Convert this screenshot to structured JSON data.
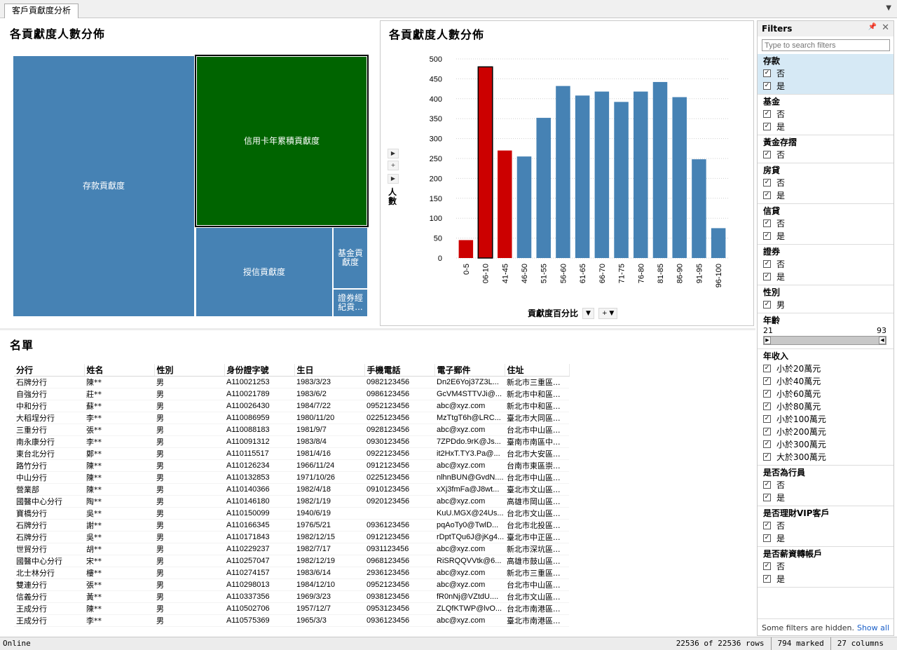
{
  "tab": {
    "label": "客戶貢獻度分析"
  },
  "treemap": {
    "title": "各貢獻度人數分佈",
    "cells": [
      {
        "label": "存款貢獻度"
      },
      {
        "label": "信用卡年累積貢獻度"
      },
      {
        "label": "授信貢獻度"
      },
      {
        "label": "基金貢獻度"
      },
      {
        "label": "證券經紀貢..."
      }
    ]
  },
  "bar": {
    "title": "各貢獻度人數分佈",
    "ylabel": "人數",
    "xlabel": "貢獻度百分比"
  },
  "chart_data": {
    "type": "bar",
    "title": "各貢獻度人數分佈",
    "xlabel": "貢獻度百分比",
    "ylabel": "人數",
    "categories": [
      "0-5",
      "06-10",
      "41-45",
      "46-50",
      "51-55",
      "56-60",
      "61-65",
      "66-70",
      "71-75",
      "76-80",
      "81-85",
      "86-90",
      "91-95",
      "96-100"
    ],
    "values": [
      45,
      480,
      270,
      255,
      352,
      432,
      408,
      418,
      392,
      418,
      442,
      404,
      248,
      75
    ],
    "marked": [
      true,
      true,
      true,
      false,
      false,
      false,
      false,
      false,
      false,
      false,
      false,
      false,
      false,
      false
    ],
    "ylim": [
      0,
      500
    ],
    "yticks": [
      0,
      50,
      100,
      150,
      200,
      250,
      300,
      350,
      400,
      450,
      500
    ],
    "colors": {
      "normal": "#4682b4",
      "marked": "#cc0000"
    },
    "grid": true
  },
  "list": {
    "title": "名單",
    "columns": [
      "分行",
      "姓名",
      "性別",
      "身份證字號",
      "生日",
      "手機電話",
      "電子郵件",
      "住址"
    ],
    "rows": [
      [
        "石牌分行",
        "陳**",
        "男",
        "A110021253",
        "1983/3/23",
        "0982123456",
        "Dn2E6Yoj37Z3L...",
        "新北市三重區..."
      ],
      [
        "自強分行",
        "莊**",
        "男",
        "A110021789",
        "1983/6/2",
        "0986123456",
        "GcVM4STTVJi@...",
        "新北市中和區..."
      ],
      [
        "中和分行",
        "蘇**",
        "男",
        "A110026430",
        "1984/7/22",
        "0952123456",
        "abc@xyz.com",
        "新北市中和區..."
      ],
      [
        "大稻埕分行",
        "李**",
        "男",
        "A110086959",
        "1980/11/20",
        "0225123456",
        "MzTtgT6h@LRC...",
        "臺北市大同區..."
      ],
      [
        "三重分行",
        "張**",
        "男",
        "A110088183",
        "1981/9/7",
        "0928123456",
        "abc@xyz.com",
        "台北市中山區..."
      ],
      [
        "南永康分行",
        "李**",
        "男",
        "A110091312",
        "1983/8/4",
        "0930123456",
        "7ZPDdo.9rK@Js...",
        "臺南市南區中..."
      ],
      [
        "東台北分行",
        "鄭**",
        "男",
        "A110115517",
        "1981/4/16",
        "0922123456",
        "it2HxT.TY3.Pa@...",
        "台北市大安區..."
      ],
      [
        "路竹分行",
        "陳**",
        "男",
        "A110126234",
        "1966/11/24",
        "0912123456",
        "abc@xyz.com",
        "台南市東區崇..."
      ],
      [
        "中山分行",
        "陳**",
        "男",
        "A110132853",
        "1971/10/26",
        "0225123456",
        "nlhnBUN@GvdN....",
        "台北市中山區..."
      ],
      [
        "營業部",
        "陳**",
        "男",
        "A110140366",
        "1982/4/18",
        "0910123456",
        "xXj3fmFa@J8wt...",
        "臺北市文山區..."
      ],
      [
        "國醫中心分行",
        "陶**",
        "男",
        "A110146180",
        "1982/1/19",
        "0920123456",
        "abc@xyz.com",
        "高雄市岡山區..."
      ],
      [
        "寶橋分行",
        "吳**",
        "男",
        "A110150099",
        "1940/6/19",
        "",
        "KuU.MGX@24Us...",
        "台北市文山區..."
      ],
      [
        "石牌分行",
        "謝**",
        "男",
        "A110166345",
        "1976/5/21",
        "0936123456",
        "pqAoTy0@TwlD...",
        "台北市北投區..."
      ],
      [
        "石牌分行",
        "吳**",
        "男",
        "A110171843",
        "1982/12/15",
        "0912123456",
        "rDptTQu6J@jKg4...",
        "臺北市中正區..."
      ],
      [
        "世貿分行",
        "胡**",
        "男",
        "A110229237",
        "1982/7/17",
        "0931123456",
        "abc@xyz.com",
        "新北市深坑區..."
      ],
      [
        "國醫中心分行",
        "宋**",
        "男",
        "A110257047",
        "1982/12/19",
        "0968123456",
        "RiSRQQVVtk@6...",
        "高雄市鼓山區..."
      ],
      [
        "北士林分行",
        "樓**",
        "男",
        "A110274157",
        "1983/6/14",
        "2936123456",
        "abc@xyz.com",
        "新北市三重區..."
      ],
      [
        "雙連分行",
        "張**",
        "男",
        "A110298013",
        "1984/12/10",
        "0952123456",
        "abc@xyz.com",
        "台北市中山區..."
      ],
      [
        "信義分行",
        "黃**",
        "男",
        "A110337356",
        "1969/3/23",
        "0938123456",
        "fR0nNj@VZtdU....",
        "台北市文山區..."
      ],
      [
        "王成分行",
        "陳**",
        "男",
        "A110502706",
        "1957/12/7",
        "0953123456",
        "ZLQfKTWP@lvO...",
        "台北市南港區..."
      ],
      [
        "王成分行",
        "李**",
        "男",
        "A110575369",
        "1965/3/3",
        "0936123456",
        "abc@xyz.com",
        "臺北市南港區..."
      ]
    ]
  },
  "filters": {
    "title": "Filters",
    "search_placeholder": "Type to search filters",
    "groups": [
      {
        "title": "存款",
        "items": [
          "否",
          "是"
        ],
        "selected": true
      },
      {
        "title": "基金",
        "items": [
          "否",
          "是"
        ]
      },
      {
        "title": "黃金存摺",
        "items": [
          "否"
        ]
      },
      {
        "title": "房貸",
        "items": [
          "否",
          "是"
        ]
      },
      {
        "title": "信貸",
        "items": [
          "否",
          "是"
        ]
      },
      {
        "title": "證券",
        "items": [
          "否",
          "是"
        ]
      },
      {
        "title": "性別",
        "items": [
          "男"
        ]
      },
      {
        "title": "年齡",
        "slider": {
          "min": "21",
          "max": "93"
        }
      },
      {
        "title": "年收入",
        "items": [
          "小於20萬元",
          "小於40萬元",
          "小於60萬元",
          "小於80萬元",
          "小於100萬元",
          "小於200萬元",
          "小於300萬元",
          "大於300萬元"
        ]
      },
      {
        "title": "是否為行員",
        "items": [
          "否",
          "是"
        ]
      },
      {
        "title": "是否理財VIP客戶",
        "items": [
          "否",
          "是"
        ]
      },
      {
        "title": "是否薪資轉帳戶",
        "items": [
          "否",
          "是"
        ]
      }
    ],
    "footer_text": "Some filters are hidden.",
    "show_all": "Show all"
  },
  "status": {
    "left": "Online",
    "rows": "22536 of 22536 rows",
    "marked": "794 marked",
    "columns": "27 columns"
  }
}
